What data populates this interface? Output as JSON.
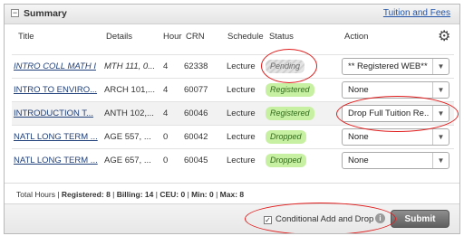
{
  "summary": {
    "title": "Summary",
    "collapse_glyph": "−",
    "tuition_link": "Tuition and Fees"
  },
  "columns": {
    "title": "Title",
    "details": "Details",
    "hours": "Hour",
    "crn": "CRN",
    "schedule": "Schedule",
    "status": "Status",
    "action": "Action"
  },
  "rows": [
    {
      "title": "INTRO COLL MATH I",
      "details": "MTH 111, 0...",
      "hours": "4",
      "crn": "62338",
      "schedule": "Lecture",
      "status": "Pending",
      "action": "** Registered WEB**"
    },
    {
      "title": "INTRO TO ENVIRO...",
      "details": "ARCH 101,...",
      "hours": "4",
      "crn": "60077",
      "schedule": "Lecture",
      "status": "Registered",
      "action": "None"
    },
    {
      "title": "INTRODUCTION T...",
      "details": "ANTH 102,...",
      "hours": "4",
      "crn": "60046",
      "schedule": "Lecture",
      "status": "Registered",
      "action": "Drop Full Tuition Re..."
    },
    {
      "title": "NATL LONG TERM ...",
      "details": "AGE 557, ...",
      "hours": "0",
      "crn": "60042",
      "schedule": "Lecture",
      "status": "Dropped",
      "action": "None"
    },
    {
      "title": "NATL LONG TERM ...",
      "details": "AGE 657, ...",
      "hours": "0",
      "crn": "60045",
      "schedule": "Lecture",
      "status": "Dropped",
      "action": "None"
    }
  ],
  "totals": {
    "prefix": "Total Hours | ",
    "registered_label": "Registered:",
    "registered": "8",
    "billing_label": "Billing:",
    "billing": "14",
    "ceu_label": "CEU:",
    "ceu": "0",
    "min_label": "Min:",
    "min": "0",
    "max_label": "Max:",
    "max": "8"
  },
  "footer": {
    "conditional_label": "Conditional Add and Drop",
    "conditional_checked": true,
    "submit_label": "Submit"
  },
  "icons": {
    "gear": "gear-icon",
    "info": "info-icon",
    "dropdown": "chevron-down-icon"
  },
  "colors": {
    "registered_badge": "#c8f0a3",
    "dropped_badge": "#c8f0a3",
    "annotation": "#e01b1b",
    "link": "#2255aa"
  }
}
